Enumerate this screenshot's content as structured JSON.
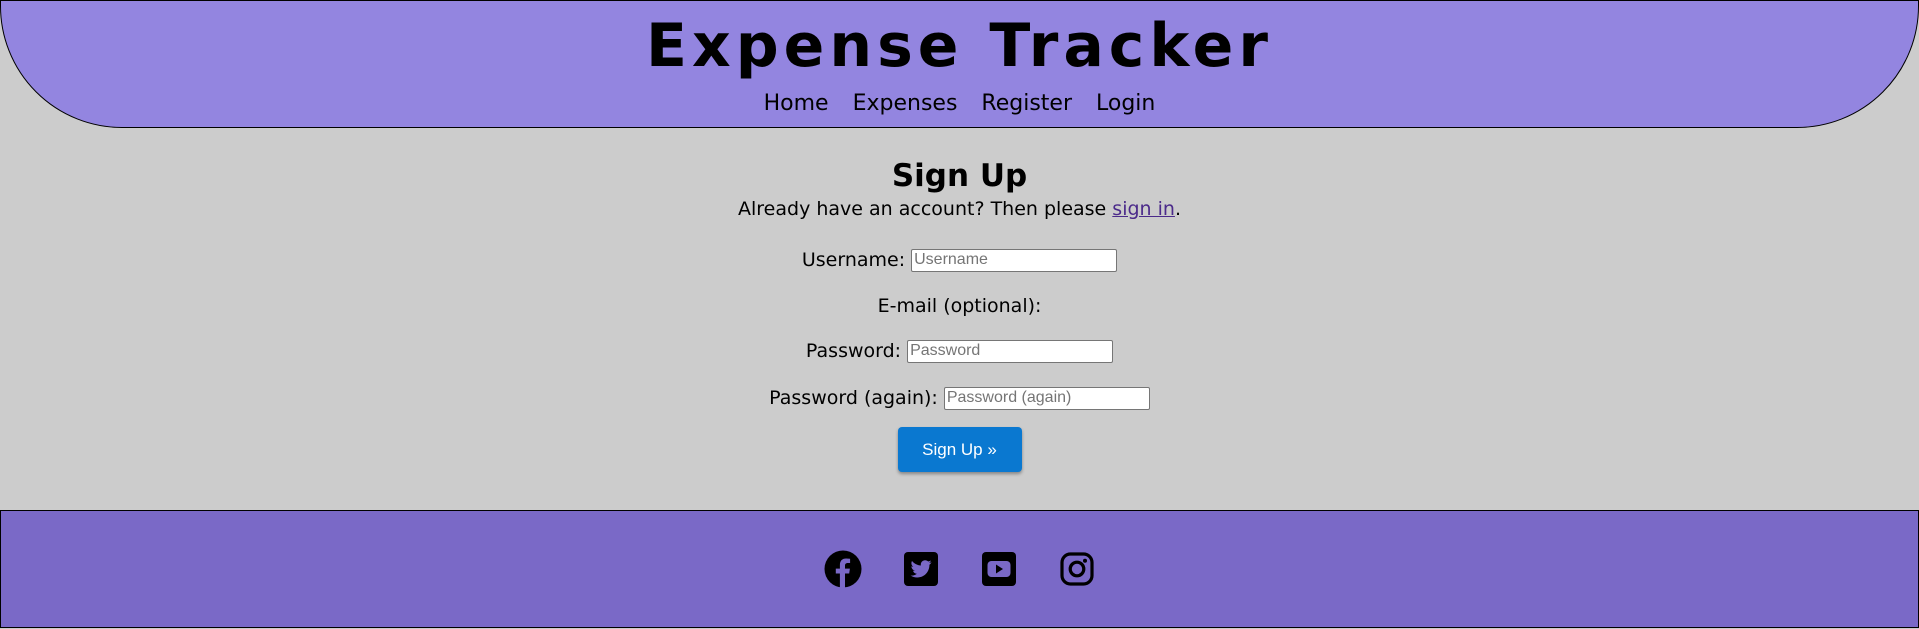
{
  "header": {
    "title": "Expense Tracker",
    "nav": [
      "Home",
      "Expenses",
      "Register",
      "Login"
    ]
  },
  "signup": {
    "heading": "Sign Up",
    "prompt_before": "Already have an account? Then please ",
    "sign_in_link": "sign in",
    "prompt_after": ".",
    "fields": {
      "username": {
        "label": "Username:",
        "placeholder": "Username",
        "value": ""
      },
      "email": {
        "label": "E-mail (optional):"
      },
      "password": {
        "label": "Password:",
        "placeholder": "Password",
        "value": ""
      },
      "password_again": {
        "label": "Password (again):",
        "placeholder": "Password (again)",
        "value": ""
      }
    },
    "submit_label": "Sign Up »"
  },
  "footer": {
    "social_icons": [
      "facebook-icon",
      "twitter-icon",
      "youtube-icon",
      "instagram-icon"
    ]
  },
  "colors": {
    "header_bg": "#9385e0",
    "page_bg": "#cccccc",
    "footer_bg": "#7a69c7",
    "button_bg": "#0a78d0",
    "link": "#4b2a8a"
  }
}
